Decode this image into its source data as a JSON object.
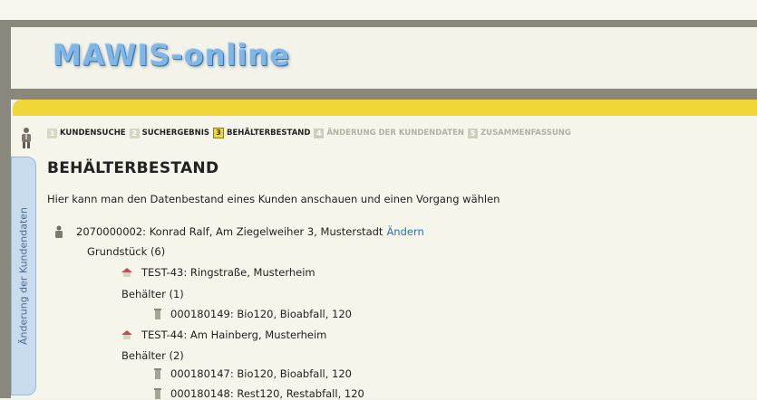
{
  "app": {
    "logo": "MAWIS-online"
  },
  "steps": [
    {
      "num": "1",
      "label": "KUNDENSUCHE"
    },
    {
      "num": "2",
      "label": "SUCHERGEBNIS"
    },
    {
      "num": "3",
      "label": "BEHÄLTERBESTAND"
    },
    {
      "num": "4",
      "label": "ÄNDERUNG DER KUNDENDATEN"
    },
    {
      "num": "5",
      "label": "ZUSAMMENFASSUNG"
    }
  ],
  "side_tab": {
    "label": "Änderung der Kundendaten"
  },
  "page": {
    "title": "BEHÄLTERBESTAND",
    "description": "Hier kann man den Datenbestand eines Kunden anschauen und einen Vorgang wählen"
  },
  "customer": {
    "text": "2070000002: Konrad Ralf, Am Ziegelweiher 3, Musterstadt",
    "edit_link": "Ändern",
    "grundstueck_label": "Grundstück (6)",
    "properties": [
      {
        "name": "TEST-43: Ringstraße, Musterheim",
        "behaelter_label": "Behälter (1)",
        "bins": [
          "000180149: Bio120, Bioabfall, 120"
        ]
      },
      {
        "name": "TEST-44: Am Hainberg, Musterheim",
        "behaelter_label": "Behälter (2)",
        "bins": [
          "000180147: Bio120, Bioabfall, 120",
          "000180148: Rest120, Restabfall, 120"
        ]
      }
    ]
  }
}
